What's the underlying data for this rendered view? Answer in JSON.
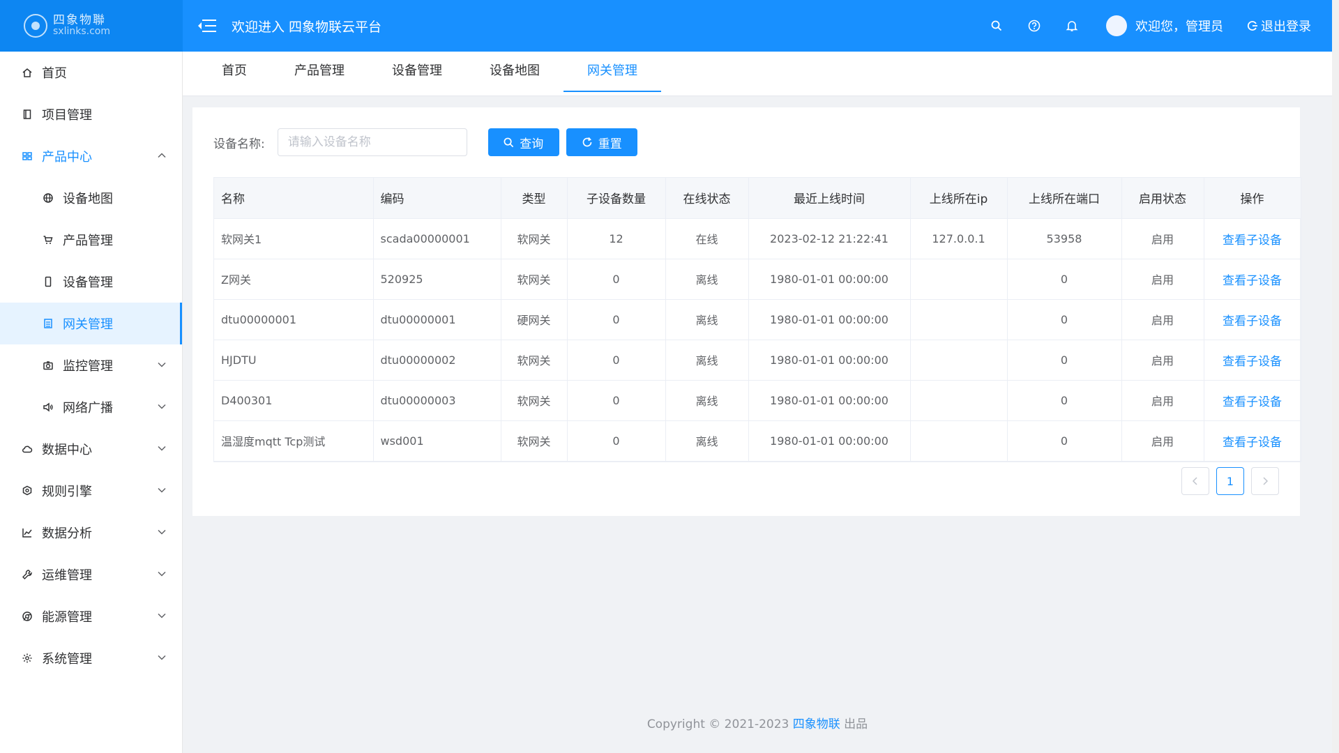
{
  "header": {
    "logo_name": "四象物聯",
    "logo_domain": "sxlinks.com",
    "title": "欢迎进入 四象物联云平台",
    "welcome": "欢迎您，管理员",
    "logout": "退出登录",
    "icons": [
      "search-icon",
      "help-icon",
      "bell-icon"
    ]
  },
  "sidebar": {
    "items": [
      {
        "label": "首页",
        "icon": "home-icon"
      },
      {
        "label": "项目管理",
        "icon": "book-icon"
      },
      {
        "label": "产品中心",
        "icon": "grid-icon",
        "state": "open"
      },
      {
        "label": "设备地图",
        "icon": "globe-icon",
        "sub": true
      },
      {
        "label": "产品管理",
        "icon": "cart-icon",
        "sub": true
      },
      {
        "label": "设备管理",
        "icon": "phone-icon",
        "sub": true
      },
      {
        "label": "网关管理",
        "icon": "list-icon",
        "sub": true,
        "state": "active"
      },
      {
        "label": "监控管理",
        "icon": "camera-icon",
        "sub": true
      },
      {
        "label": "网络广播",
        "icon": "speaker-icon",
        "sub": true
      },
      {
        "label": "数据中心",
        "icon": "cloud-icon"
      },
      {
        "label": "规则引擎",
        "icon": "gear-alt-icon"
      },
      {
        "label": "数据分析",
        "icon": "chart-icon"
      },
      {
        "label": "运维管理",
        "icon": "wrench-icon"
      },
      {
        "label": "能源管理",
        "icon": "chrome-icon"
      },
      {
        "label": "系统管理",
        "icon": "settings-icon"
      }
    ]
  },
  "tabs": [
    {
      "label": "首页"
    },
    {
      "label": "产品管理"
    },
    {
      "label": "设备管理"
    },
    {
      "label": "设备地图"
    },
    {
      "label": "网关管理",
      "active": true
    }
  ],
  "search": {
    "label": "设备名称:",
    "placeholder": "请输入设备名称",
    "value": "",
    "query_label": "查询",
    "reset_label": "重置"
  },
  "table": {
    "columns": [
      "名称",
      "编码",
      "类型",
      "子设备数量",
      "在线状态",
      "最近上线时间",
      "上线所在ip",
      "上线所在端口",
      "启用状态",
      "操作"
    ],
    "rows": [
      [
        "软网关1",
        "scada00000001",
        "软网关",
        "12",
        "在线",
        "2023-02-12 21:22:41",
        "127.0.0.1",
        "53958",
        "启用",
        "查看子设备"
      ],
      [
        "Z网关",
        "520925",
        "软网关",
        "0",
        "离线",
        "1980-01-01 00:00:00",
        "",
        "0",
        "启用",
        "查看子设备"
      ],
      [
        "dtu00000001",
        "dtu00000001",
        "硬网关",
        "0",
        "离线",
        "1980-01-01 00:00:00",
        "",
        "0",
        "启用",
        "查看子设备"
      ],
      [
        "HJDTU",
        "dtu00000002",
        "软网关",
        "0",
        "离线",
        "1980-01-01 00:00:00",
        "",
        "0",
        "启用",
        "查看子设备"
      ],
      [
        "D400301",
        "dtu00000003",
        "软网关",
        "0",
        "离线",
        "1980-01-01 00:00:00",
        "",
        "0",
        "启用",
        "查看子设备"
      ],
      [
        "温湿度mqtt Tcp测试",
        "wsd001",
        "软网关",
        "0",
        "离线",
        "1980-01-01 00:00:00",
        "",
        "0",
        "启用",
        "查看子设备"
      ]
    ]
  },
  "pagination": {
    "current": "1"
  },
  "footer": {
    "prefix": "Copyright © 2021-2023 ",
    "brand": "四象物联",
    "suffix": " 出品"
  },
  "colors": {
    "primary": "#1890ff",
    "active_bg": "#e6f3ff"
  }
}
